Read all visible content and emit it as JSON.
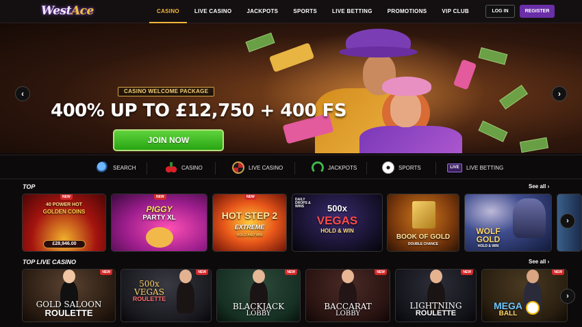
{
  "header": {
    "logo_text": "WestAce",
    "logo_part1": "West",
    "logo_part2": "Ace",
    "nav": [
      "CASINO",
      "LIVE CASINO",
      "JACKPOTS",
      "SPORTS",
      "LIVE BETTING",
      "PROMOTIONS",
      "VIP CLUB"
    ],
    "login_label": "LOG IN",
    "register_label": "REGISTER"
  },
  "hero": {
    "badge": "CASINO WELCOME PACKAGE",
    "headline": "400% UP TO £12,750 + 400 FS",
    "cta": "JOIN NOW",
    "prev": "‹",
    "next": "›"
  },
  "quicknav": {
    "items": [
      "SEARCH",
      "CASINO",
      "LIVE CASINO",
      "JACKPOTS",
      "SPORTS",
      "LIVE BETTING"
    ],
    "icons": [
      "search-icon",
      "cherry-icon",
      "roulette-icon",
      "horseshoe-icon",
      "football-icon",
      "live-icon"
    ],
    "live_badge": "LIVE"
  },
  "top": {
    "title": "TOP",
    "see_all": "See all",
    "games": [
      {
        "name": "40 POWER HOT GOLDEN COINS",
        "line1": "40 POWER HOT",
        "line2": "GOLDEN COINS",
        "tag": "NEW",
        "jackpot": "£28,946.00"
      },
      {
        "name": "PIGGY PARTY XL",
        "line1": "PIGGY",
        "line2": "PARTY XL",
        "tag": "NEW"
      },
      {
        "name": "HOT STEP 2 EXTREME",
        "line1": "HOT STEP 2",
        "line2": "EXTREME",
        "sub": "HOLD AND WIN",
        "tag": "NEW"
      },
      {
        "name": "500x VEGAS HOLD & WIN",
        "line1": "500x",
        "line2": "VEGAS",
        "sub": "HOLD & WIN",
        "corner": "DAILY DROPS & WINS"
      },
      {
        "name": "BOOK OF GOLD DOUBLE CHANCE",
        "line1": "BOOK OF GOLD",
        "sub": "DOUBLE CHANCE"
      },
      {
        "name": "WOLF GOLD HOLD & WIN",
        "line1": "WOLF",
        "line2": "GOLD",
        "sub": "HOLD & WIN"
      }
    ]
  },
  "live": {
    "title": "TOP LIVE CASINO",
    "see_all": "See all",
    "tables": [
      {
        "line1": "GOLD SALOON",
        "line2": "ROULETTE",
        "tag": "NEW"
      },
      {
        "line1": "500x VEGAS",
        "line2": "ROULETTE",
        "tag": "NEW"
      },
      {
        "line1": "BLACKJACK",
        "line2": "LOBBY",
        "tag": "NEW"
      },
      {
        "line1": "BACCARAT",
        "line2": "LOBBY",
        "tag": "NEW"
      },
      {
        "line1": "LIGHTNING",
        "line2": "ROULETTE",
        "tag": "NEW"
      },
      {
        "line1": "MEGA",
        "line2": "BALL",
        "tag": "NEW"
      }
    ]
  }
}
